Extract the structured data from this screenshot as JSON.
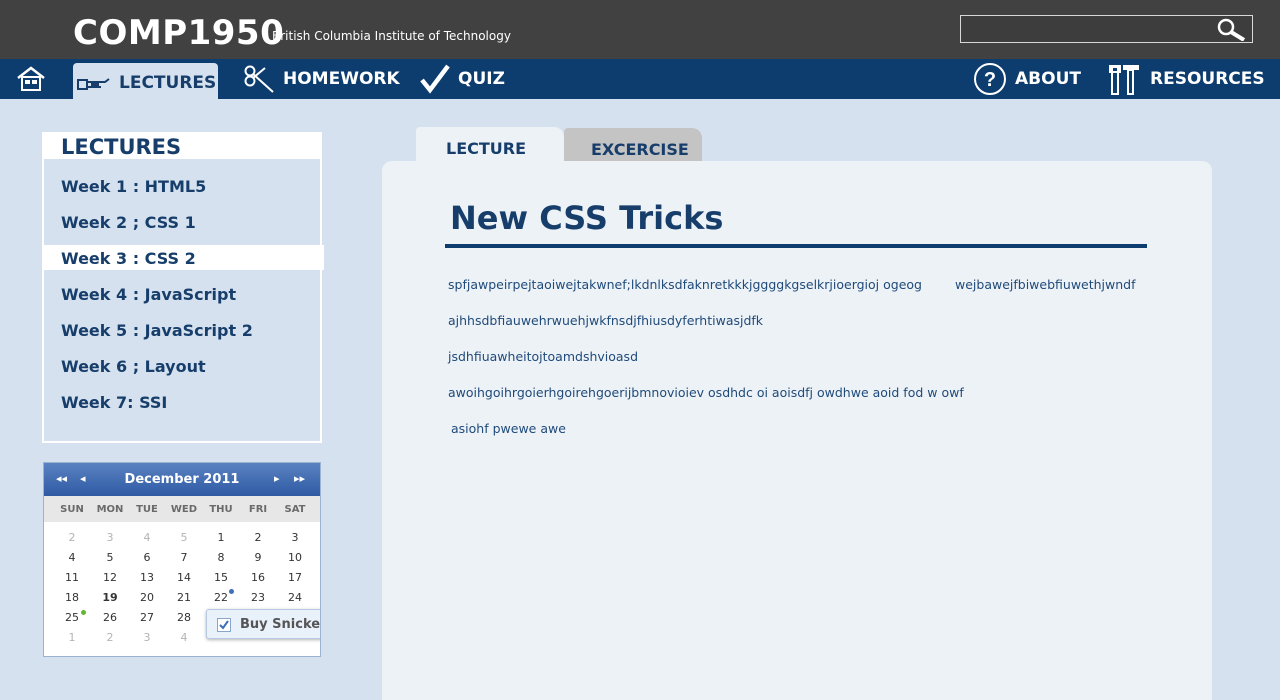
{
  "header": {
    "brand": "COMP1950",
    "subtitle": "British Columbia Institute of Technology",
    "search_placeholder": ""
  },
  "nav": {
    "home_icon": "home-icon",
    "items": [
      {
        "label": "LECTURES",
        "icon": "hand-pointer-icon",
        "active": true
      },
      {
        "label": "HOMEWORK",
        "icon": "scissors-icon"
      },
      {
        "label": "QUIZ",
        "icon": "checkmark-icon"
      },
      {
        "label": "ABOUT",
        "icon": "question-circle-icon"
      },
      {
        "label": "RESOURCES",
        "icon": "tools-icon"
      }
    ]
  },
  "sidebar": {
    "title": "LECTURES",
    "weeks": [
      "Week 1 : HTML5",
      "Week 2 ; CSS 1",
      "Week 3 : CSS 2",
      "Week 4 : JavaScript",
      "Week 5 : JavaScript 2",
      "Week 6 ; Layout",
      "Week 7: SSI"
    ],
    "active_week_index": 2
  },
  "calendar": {
    "title": "December 2011",
    "nav": {
      "prev_year": "◂◂",
      "prev": "◂",
      "next": "▸",
      "next_year": "▸▸"
    },
    "days": [
      "SUN",
      "MON",
      "TUE",
      "WED",
      "THU",
      "FRI",
      "SAT"
    ],
    "rows": [
      [
        "2",
        "3",
        "4",
        "5",
        "1",
        "2",
        "3"
      ],
      [
        "4",
        "5",
        "6",
        "7",
        "8",
        "9",
        "10"
      ],
      [
        "11",
        "12",
        "13",
        "14",
        "15",
        "16",
        "17"
      ],
      [
        "18",
        "19",
        "20",
        "21",
        "22",
        "23",
        "24"
      ],
      [
        "25",
        "26",
        "27",
        "28",
        "",
        "",
        ""
      ],
      [
        "1",
        "2",
        "3",
        "4",
        "",
        "",
        ""
      ]
    ],
    "tooltip": "Buy Snickers",
    "colors": {
      "green_dot": "#5fb830",
      "blue_dot": "#3f6fb5"
    }
  },
  "tabs": {
    "lecture": "LECTURE",
    "exercise": "EXCERCISE"
  },
  "content": {
    "title": "New CSS Tricks",
    "lines": [
      "spfjawpeirpejtaoiwejtakwnef;lkdnlksdfaknretkkkjggggkgselkrjioergioj ogeog",
      "wejbawejfbiwebfiuwethjwndf",
      "ajhhsdbfiauwehrwuehjwkfnsdjfhiusdyferhtiwasjdfk",
      "jsdhfiuawheitojtoamdshvioasd",
      "awoihgoihrgoierhgoirehgoerijbmnovioiev   osdhdc oi aoisdfj owdhwe  aoid fod w owf",
      "asiohf pwewe awe"
    ]
  },
  "colors": {
    "topbar": "#414141",
    "navbar": "#0d3d6f",
    "page_bg": "#d5e1ee",
    "content_bg": "#edf2f7",
    "text_dark": "#173e6b"
  }
}
